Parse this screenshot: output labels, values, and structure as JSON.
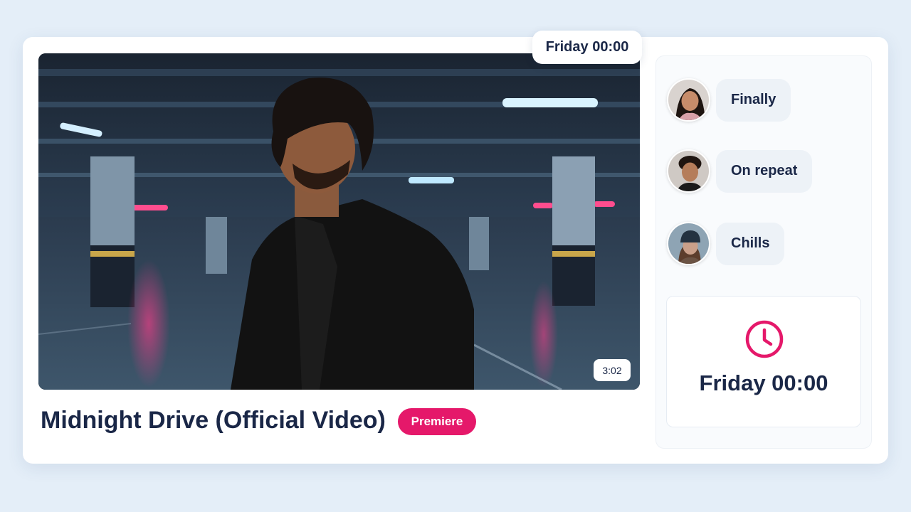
{
  "video": {
    "title": "Midnight Drive (Official Video)",
    "badge": "Premiere",
    "premiere_time": "Friday 00:00",
    "duration": "3:02"
  },
  "comments": [
    {
      "text": "Finally",
      "avatar": "woman-avatar"
    },
    {
      "text": "On repeat",
      "avatar": "man-avatar"
    },
    {
      "text": "Chills",
      "avatar": "woman-beanie-avatar"
    }
  ],
  "countdown": {
    "time": "Friday 00:00",
    "icon": "clock-icon"
  },
  "colors": {
    "accent": "#e5186a",
    "text": "#1a2747",
    "background": "#e4eef8"
  }
}
